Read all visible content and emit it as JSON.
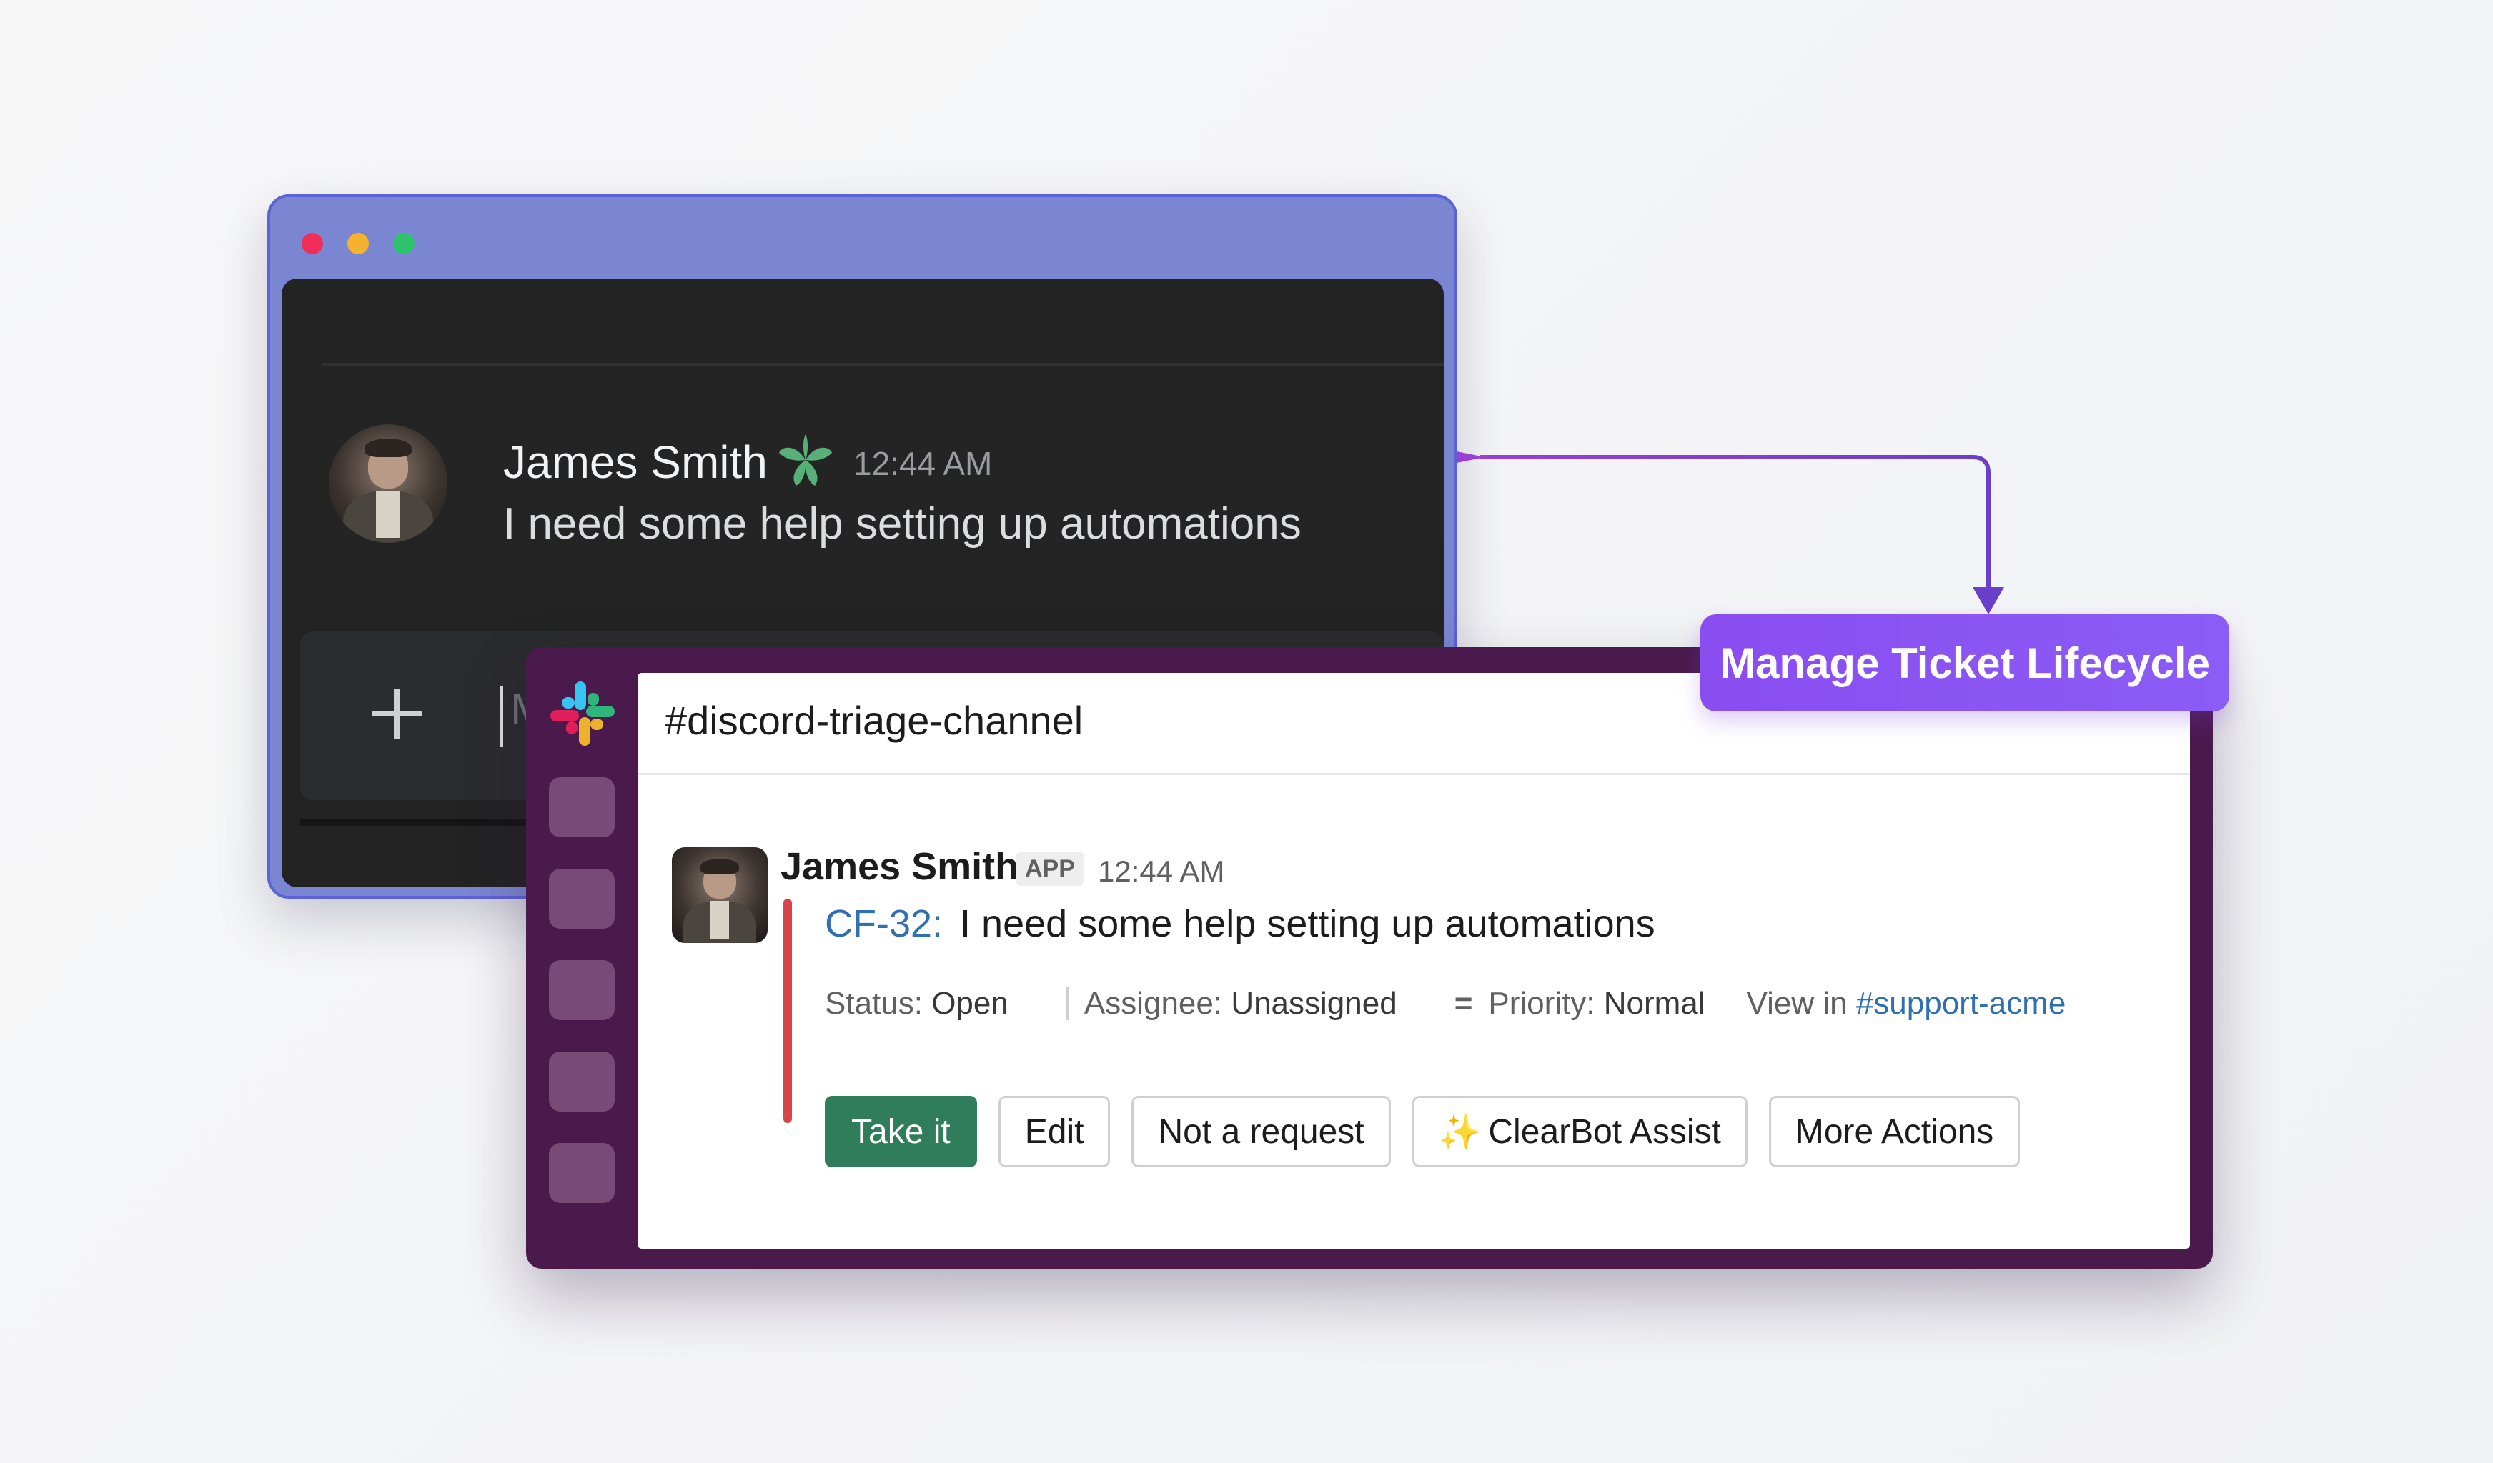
{
  "discord": {
    "user_name": "James Smith",
    "timestamp": "12:44 AM",
    "message": "I need some help setting up automations",
    "input_placeholder": "M",
    "badge_icon": "leaf-badge-icon",
    "window_colors": {
      "frame": "#7b86d2",
      "panel": "#232324"
    }
  },
  "slack": {
    "channel": "#discord-triage-channel",
    "sender": "James Smith",
    "app_badge": "APP",
    "timestamp": "12:44 AM",
    "ticket_id": "CF-32:",
    "ticket_text": "I need some help setting up automations",
    "meta": {
      "status_label": "Status:",
      "status_value": "Open",
      "assignee_label": "Assignee:",
      "assignee_value": "Unassigned",
      "priority_icon": "=",
      "priority_label": "Priority:",
      "priority_value": "Normal",
      "view_label": "View in",
      "view_link": "#support-acme"
    },
    "buttons": {
      "take_it": "Take it",
      "edit": "Edit",
      "not_request": "Not a request",
      "sparkle": "✨",
      "clearbot": "ClearBot Assist",
      "more_actions": "More Actions"
    },
    "colors": {
      "sidebar": "#4b1a4d",
      "primary_button": "#2f7d5b",
      "accent_bar": "#d9444b",
      "link": "#2f6fb2"
    }
  },
  "label": {
    "text": "Manage Ticket Lifecycle",
    "color": "#8a4df0"
  }
}
